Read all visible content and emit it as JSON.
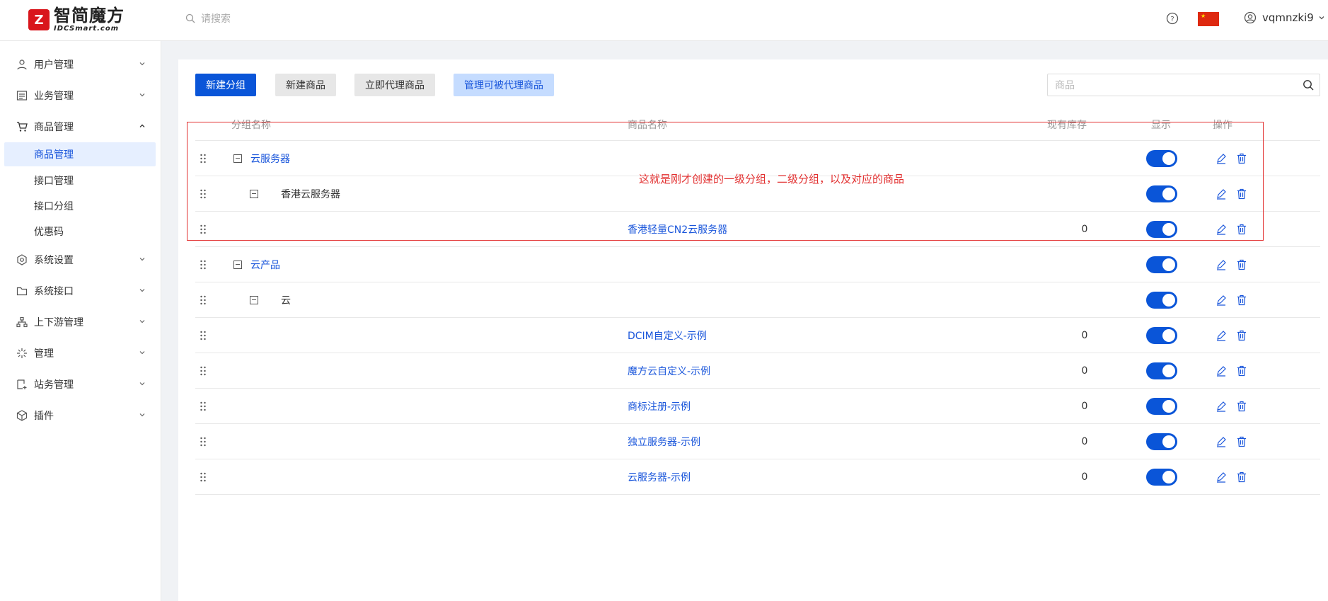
{
  "header": {
    "logo_cn": "智简魔方",
    "logo_en": "IDCSmart.com",
    "search_placeholder": "请搜索",
    "username": "vqmnzki9",
    "flag_colors": {
      "red": "#de2910",
      "star": "#ffde00"
    }
  },
  "sidebar": {
    "items": [
      {
        "label": "用户管理",
        "icon": "user-icon"
      },
      {
        "label": "业务管理",
        "icon": "list-icon"
      },
      {
        "label": "商品管理",
        "icon": "cart-icon",
        "expanded": true
      },
      {
        "label": "系统设置",
        "icon": "gear-icon"
      },
      {
        "label": "系统接口",
        "icon": "folder-icon"
      },
      {
        "label": "上下游管理",
        "icon": "network-icon"
      },
      {
        "label": "管理",
        "icon": "spark-icon"
      },
      {
        "label": "站务管理",
        "icon": "page-icon"
      },
      {
        "label": "插件",
        "icon": "cube-icon"
      }
    ],
    "sub_items": [
      {
        "label": "商品管理",
        "active": true
      },
      {
        "label": "接口管理"
      },
      {
        "label": "接口分组"
      },
      {
        "label": "优惠码"
      }
    ]
  },
  "toolbar": {
    "new_group": "新建分组",
    "new_product": "新建商品",
    "proxy_product": "立即代理商品",
    "manage_proxied": "管理可被代理商品",
    "search_placeholder": "商品"
  },
  "table": {
    "headers": {
      "group_name": "分组名称",
      "product_name": "商品名称",
      "stock": "现有库存",
      "display": "显示",
      "actions": "操作"
    },
    "rows": [
      {
        "level": 1,
        "group": "云服务器",
        "product": "",
        "stock": "",
        "display": true
      },
      {
        "level": 2,
        "group": "香港云服务器",
        "product": "",
        "stock": "",
        "display": true
      },
      {
        "level": 3,
        "group": "",
        "product": "香港轻量CN2云服务器",
        "stock": "0",
        "display": true
      },
      {
        "level": 1,
        "group": "云产品",
        "product": "",
        "stock": "",
        "display": true
      },
      {
        "level": 2,
        "group": "云",
        "product": "",
        "stock": "",
        "display": true
      },
      {
        "level": 3,
        "group": "",
        "product": "DCIM自定义-示例",
        "stock": "0",
        "display": true
      },
      {
        "level": 3,
        "group": "",
        "product": "魔方云自定义-示例",
        "stock": "0",
        "display": true
      },
      {
        "level": 3,
        "group": "",
        "product": "商标注册-示例",
        "stock": "0",
        "display": true
      },
      {
        "level": 3,
        "group": "",
        "product": "独立服务器-示例",
        "stock": "0",
        "display": true
      },
      {
        "level": 3,
        "group": "",
        "product": "云服务器-示例",
        "stock": "0",
        "display": true
      }
    ]
  },
  "annotation": {
    "text": "这就是刚才创建的一级分组，二级分组，以及对应的商品",
    "color": "#e23030"
  },
  "colors": {
    "accent": "#0a55d8",
    "link": "#1a56db"
  }
}
